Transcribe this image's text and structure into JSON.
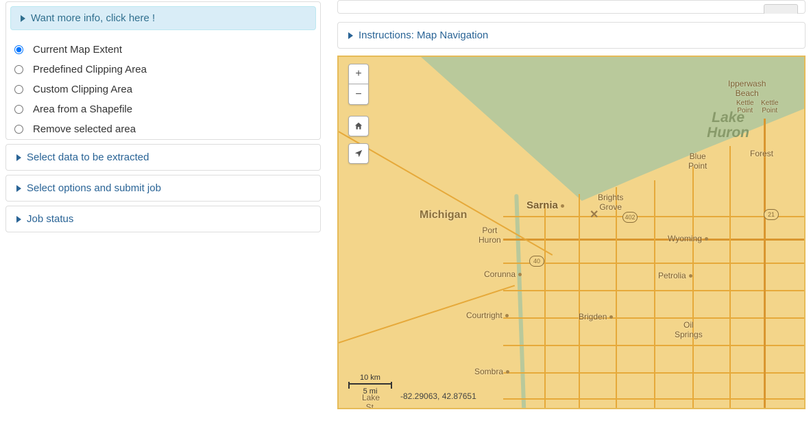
{
  "left": {
    "info_banner": "Want more info, click here !",
    "clip_options": [
      "Current Map Extent",
      "Predefined Clipping Area",
      "Custom Clipping Area",
      "Area from a Shapefile",
      "Remove selected area"
    ],
    "clip_selected_index": 0,
    "accordion": {
      "select_data": "Select data to be extracted",
      "select_options": "Select options and submit job",
      "job_status": "Job status"
    }
  },
  "right": {
    "instructions": "Instructions: Map Navigation"
  },
  "map": {
    "lake_label_line1": "Lake",
    "lake_label_line2": "Huron",
    "places": {
      "michigan": "Michigan",
      "sarnia": "Sarnia",
      "port_huron": "Port\nHuron",
      "brights_grove": "Brights\nGrove",
      "blue_point": "Blue\nPoint",
      "forest": "Forest",
      "ipperwash": "Ipperwash\nBeach",
      "kettle_point": "Kettle\nPoint",
      "kettle_point2": "Kettle\nPoint",
      "wyoming": "Wyoming",
      "petrolia": "Petrolia",
      "corunna": "Corunna",
      "courtright": "Courtright",
      "brigden": "Brigden",
      "oil_springs": "Oil\nSprings",
      "sombra": "Sombra",
      "lake_st": "Lake\nSt."
    },
    "shields": {
      "r40": "40",
      "r402": "402",
      "r21": "21"
    },
    "scale_km": "10 km",
    "scale_mi": "5 mi",
    "coords": "-82.29063, 42.87651"
  }
}
